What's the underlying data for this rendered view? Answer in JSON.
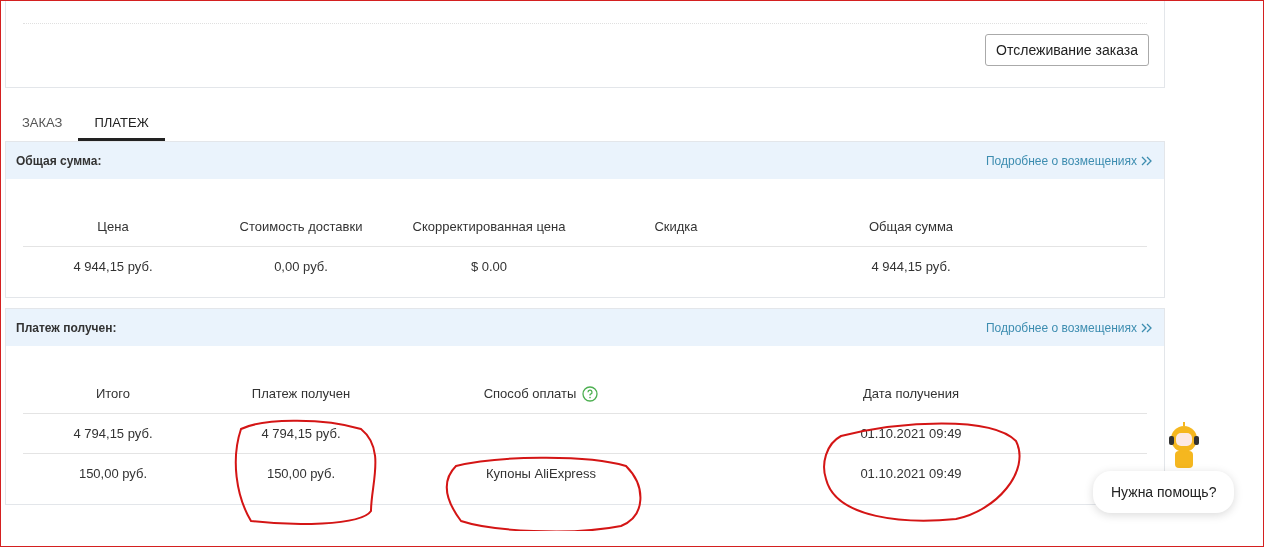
{
  "top_card": {
    "button": "Отслеживание заказа"
  },
  "tabs": [
    {
      "label": "ЗАКАЗ",
      "selected": false
    },
    {
      "label": "ПЛАТЕЖ",
      "selected": true
    }
  ],
  "sections": [
    {
      "kind": "totals",
      "title": "Общая сумма:",
      "link": "Подробнее о возмещениях",
      "columns": [
        {
          "label": "Цена",
          "help": false
        },
        {
          "label": "Стоимость доставки",
          "help": false
        },
        {
          "label": "Скорректированная цена",
          "help": false
        },
        {
          "label": "Скидка",
          "help": false
        },
        {
          "label": "Общая сумма",
          "help": false
        }
      ],
      "rows": [
        [
          "4 944,15 руб.",
          "0,00 руб.",
          "$ 0.00",
          null,
          "4 944,15 руб."
        ]
      ]
    },
    {
      "kind": "payments",
      "title": "Платеж получен:",
      "link": "Подробнее о возмещениях",
      "columns": [
        {
          "label": "Итого",
          "help": false
        },
        {
          "label": "Платеж получен",
          "help": false
        },
        {
          "label": "Способ оплаты",
          "help": true
        },
        {
          "label": "Дата получения",
          "help": false
        }
      ],
      "rows": [
        [
          "4 794,15 руб.",
          "4 794,15 руб.",
          null,
          "01.10.2021 09:49"
        ],
        [
          "150,00 руб.",
          "150,00 руб.",
          "Купоны AliExpress",
          "01.10.2021 09:49"
        ]
      ]
    }
  ],
  "help": {
    "label": "Нужна помощь?"
  }
}
